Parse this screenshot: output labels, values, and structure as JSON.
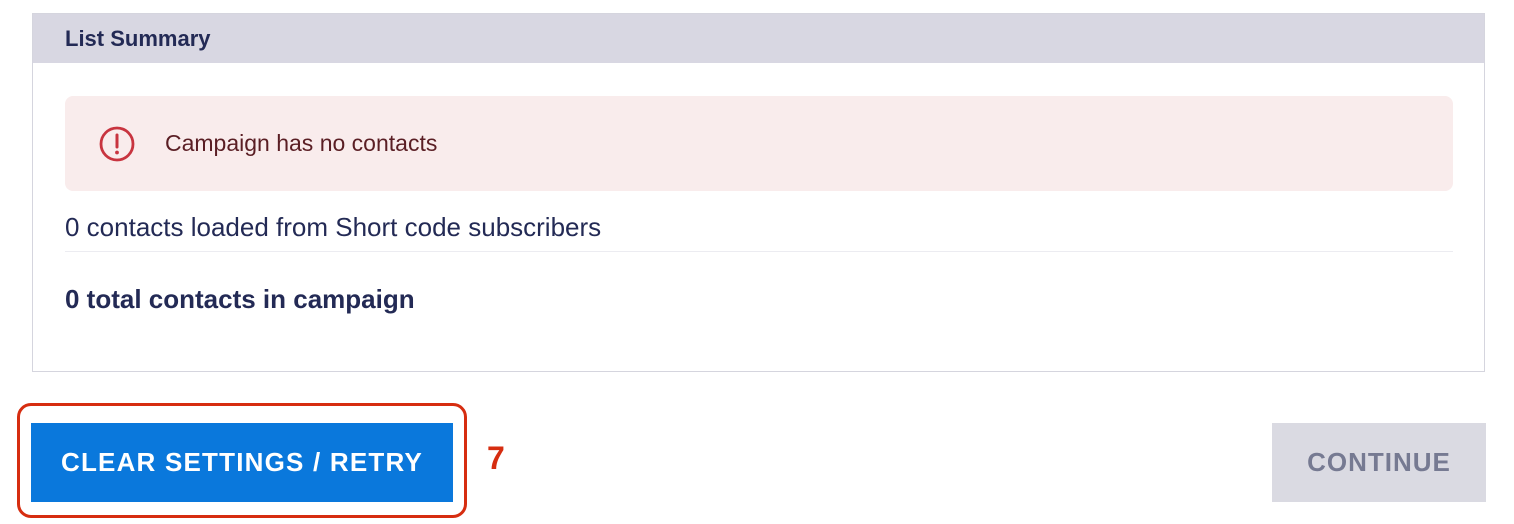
{
  "list_summary": {
    "title": "List Summary",
    "alert": {
      "icon": "exclamation-circle-icon",
      "message": "Campaign has no contacts"
    },
    "loaded_text": "0 contacts loaded from Short code subscribers",
    "total_text": "0 total contacts in campaign"
  },
  "actions": {
    "clear_label": "CLEAR SETTINGS / RETRY",
    "continue_label": "CONTINUE",
    "step_number": "7"
  },
  "colors": {
    "header_bg": "#d8d7e2",
    "primary": "#0a78dc",
    "alert_bg": "#f9ecec",
    "alert_icon": "#c8343f",
    "annotation": "#d62d10",
    "disabled_bg": "#dadae2",
    "text": "#232a55"
  }
}
